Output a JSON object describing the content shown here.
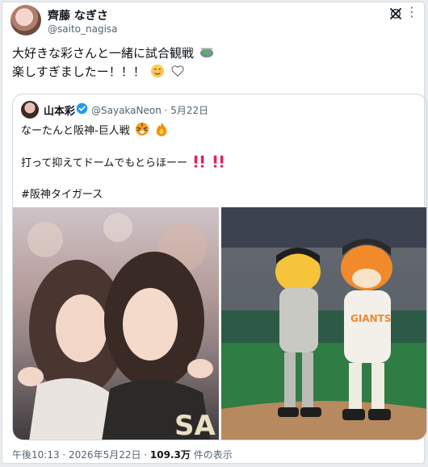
{
  "post": {
    "author_name": "齊藤 なぎさ",
    "author_handle": "@saito_nagisa",
    "text_line1": "大好きな彩さんと一緒に試合観戦",
    "text_line2": "楽しすぎましたー！！！"
  },
  "quote": {
    "author_name": "山本彩",
    "author_handle": "@SayakaNeon · 5月22日",
    "line1": "なーたんと阪神-巨人戦",
    "line2": "打って抑えてドームでもとらほーー",
    "hashtag": "#阪神タイガース"
  },
  "footer": {
    "time": "午後10:13 · 2026年5月22日 · ",
    "views": "109.3万",
    "views_suffix": " 件の表示"
  },
  "icons": {
    "menu": "more-options-icon",
    "brand": "x-logo-icon",
    "verified": "verified-badge-icon",
    "stadium": "stadium-emoji-icon",
    "smile": "smiling-face-emoji-icon",
    "heart": "white-heart-emoji-icon",
    "tiger": "tiger-emoji-icon",
    "fire": "fire-emoji-icon",
    "exclamation": "double-exclamation-emoji-icon"
  },
  "colors": {
    "verified": "#1d9bf0",
    "text": "#0f1419",
    "muted": "#536471",
    "exclamation": "#e0245e"
  }
}
